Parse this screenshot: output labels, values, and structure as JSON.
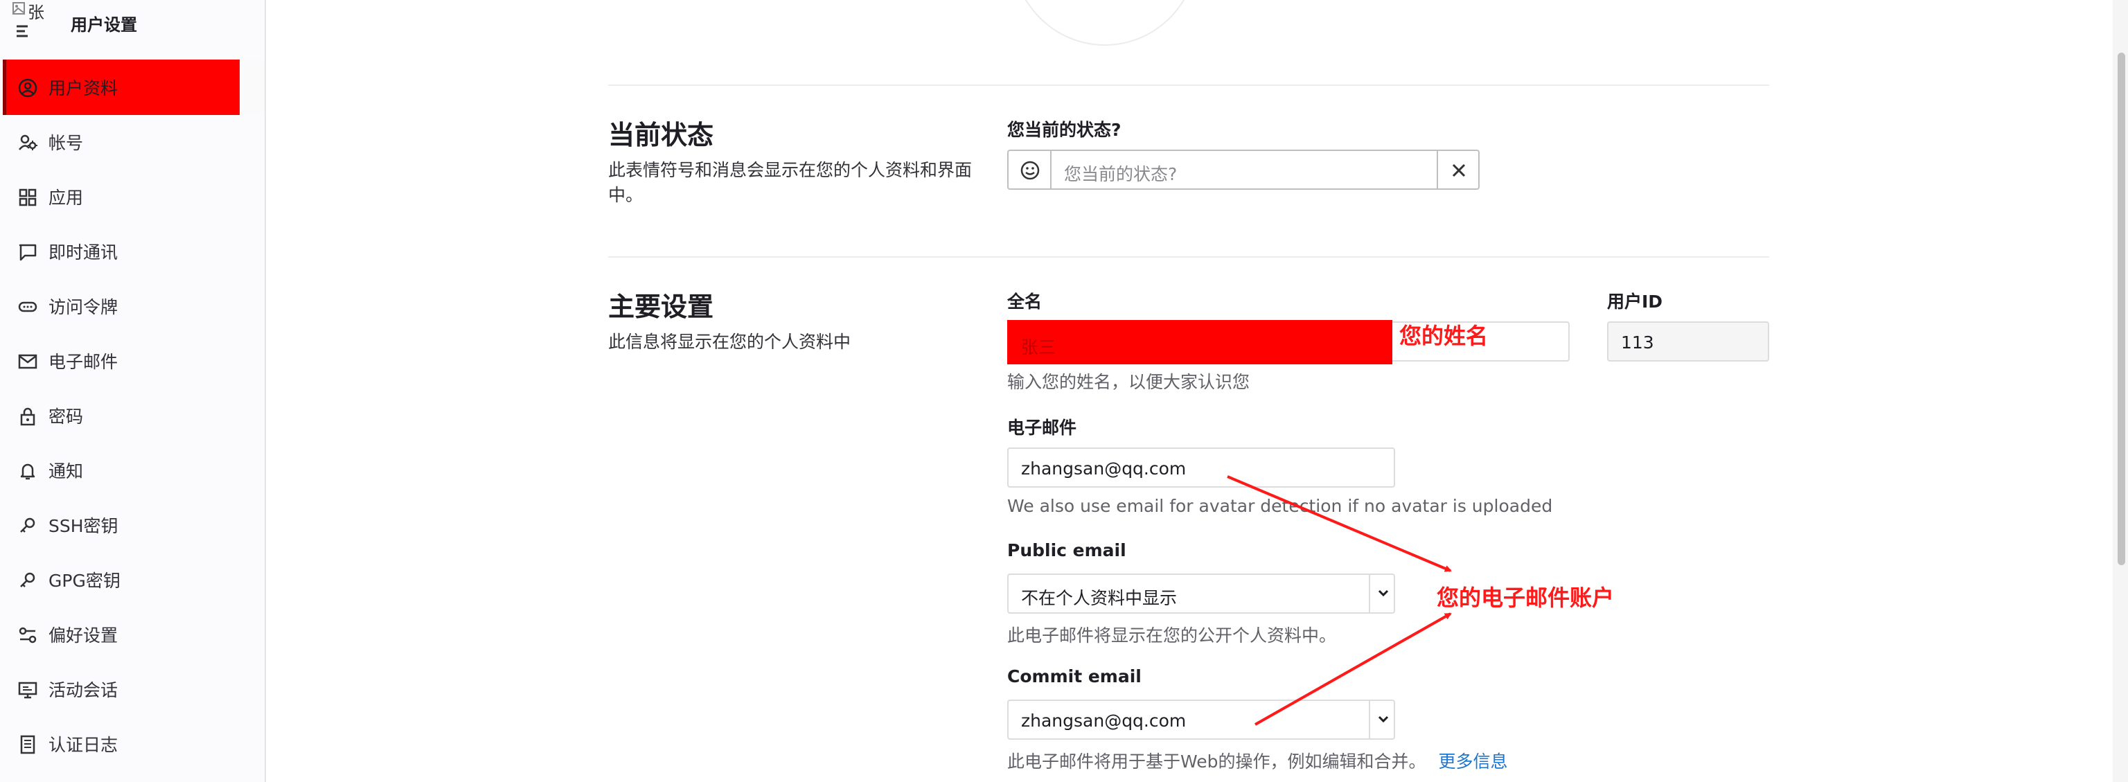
{
  "sidebar": {
    "title": "用户设置",
    "avatar_alt": "张",
    "items": [
      {
        "label": "用户资料",
        "icon": "user-circle-icon",
        "active": true
      },
      {
        "label": "帐号",
        "icon": "user-gear-icon"
      },
      {
        "label": "应用",
        "icon": "applications-icon"
      },
      {
        "label": "即时通讯",
        "icon": "chat-icon"
      },
      {
        "label": "访问令牌",
        "icon": "token-icon"
      },
      {
        "label": "电子邮件",
        "icon": "mail-icon"
      },
      {
        "label": "密码",
        "icon": "lock-icon"
      },
      {
        "label": "通知",
        "icon": "bell-icon"
      },
      {
        "label": "SSH密钥",
        "icon": "key-icon"
      },
      {
        "label": "GPG密钥",
        "icon": "key-icon"
      },
      {
        "label": "偏好设置",
        "icon": "preferences-icon"
      },
      {
        "label": "活动会话",
        "icon": "monitor-icon"
      },
      {
        "label": "认证日志",
        "icon": "log-icon"
      }
    ],
    "active_color": "#ff0000"
  },
  "status_section": {
    "title": "当前状态",
    "description": "此表情符号和消息会显示在您的个人资料和界面中。",
    "field_label": "您当前的状态?",
    "placeholder": "您当前的状态?",
    "emoji_icon": "smiley-icon",
    "clear_icon": "close-icon"
  },
  "main_section": {
    "title": "主要设置",
    "description": "此信息将显示在您的个人资料中",
    "full_name": {
      "label": "全名",
      "value": "张三",
      "help": "输入您的姓名，以便大家认识您"
    },
    "user_id": {
      "label": "用户ID",
      "value": "113"
    },
    "email": {
      "label": "电子邮件",
      "value": "zhangsan@qq.com",
      "help": "We also use email for avatar detection if no avatar is uploaded"
    },
    "public_email": {
      "label": "Public email",
      "value": "不在个人资料中显示",
      "help": "此电子邮件将显示在您的公开个人资料中。"
    },
    "commit_email": {
      "label": "Commit email",
      "value": "zhangsan@qq.com",
      "help": "此电子邮件将用于基于Web的操作，例如编辑和合并。",
      "more_link": "更多信息"
    }
  },
  "annotations": {
    "name_note": "您的姓名",
    "email_note": "您的电子邮件账户",
    "color": "#ff1a1a"
  }
}
